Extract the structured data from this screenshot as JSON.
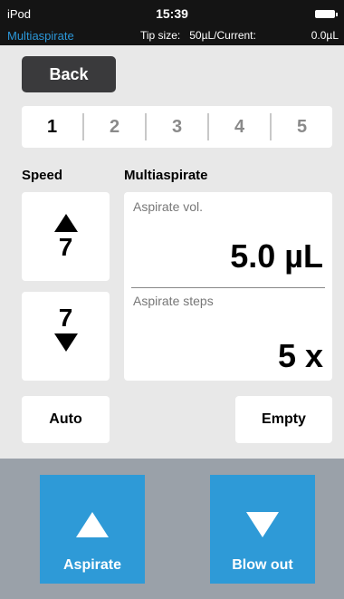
{
  "status": {
    "carrier": "iPod",
    "time": "15:39",
    "mode": "Multiaspirate",
    "tip_size_label": "Tip size:",
    "tip_size_value": "50µL/Current:",
    "current_value": "0.0µL"
  },
  "nav": {
    "back_label": "Back"
  },
  "presets": {
    "items": [
      "1",
      "2",
      "3",
      "4",
      "5"
    ],
    "selected": "1"
  },
  "speed": {
    "label": "Speed",
    "up_value": "7",
    "down_value": "7"
  },
  "multiaspirate": {
    "label": "Multiaspirate",
    "aspirate_vol_label": "Aspirate vol.",
    "aspirate_vol_value": "5.0 µL",
    "aspirate_steps_label": "Aspirate steps",
    "aspirate_steps_value": "5 x"
  },
  "buttons": {
    "auto_label": "Auto",
    "empty_label": "Empty",
    "aspirate_label": "Aspirate",
    "blowout_label": "Blow out"
  },
  "colors": {
    "accent": "#2e9ad7",
    "mode_text": "#2b97d8",
    "statusbar": "#141414",
    "footer": "#9aa1a9"
  }
}
